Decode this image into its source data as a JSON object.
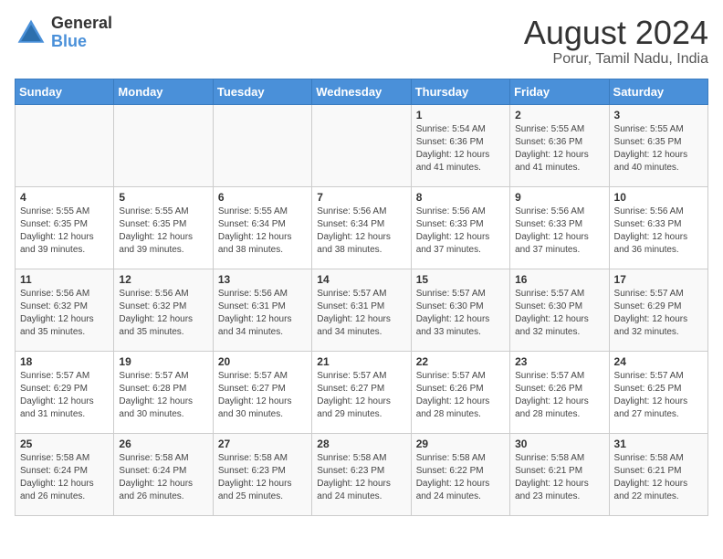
{
  "header": {
    "logo_general": "General",
    "logo_blue": "Blue",
    "main_title": "August 2024",
    "subtitle": "Porur, Tamil Nadu, India"
  },
  "calendar": {
    "days_of_week": [
      "Sunday",
      "Monday",
      "Tuesday",
      "Wednesday",
      "Thursday",
      "Friday",
      "Saturday"
    ],
    "weeks": [
      [
        {
          "day": "",
          "info": ""
        },
        {
          "day": "",
          "info": ""
        },
        {
          "day": "",
          "info": ""
        },
        {
          "day": "",
          "info": ""
        },
        {
          "day": "1",
          "info": "Sunrise: 5:54 AM\nSunset: 6:36 PM\nDaylight: 12 hours\nand 41 minutes."
        },
        {
          "day": "2",
          "info": "Sunrise: 5:55 AM\nSunset: 6:36 PM\nDaylight: 12 hours\nand 41 minutes."
        },
        {
          "day": "3",
          "info": "Sunrise: 5:55 AM\nSunset: 6:35 PM\nDaylight: 12 hours\nand 40 minutes."
        }
      ],
      [
        {
          "day": "4",
          "info": "Sunrise: 5:55 AM\nSunset: 6:35 PM\nDaylight: 12 hours\nand 39 minutes."
        },
        {
          "day": "5",
          "info": "Sunrise: 5:55 AM\nSunset: 6:35 PM\nDaylight: 12 hours\nand 39 minutes."
        },
        {
          "day": "6",
          "info": "Sunrise: 5:55 AM\nSunset: 6:34 PM\nDaylight: 12 hours\nand 38 minutes."
        },
        {
          "day": "7",
          "info": "Sunrise: 5:56 AM\nSunset: 6:34 PM\nDaylight: 12 hours\nand 38 minutes."
        },
        {
          "day": "8",
          "info": "Sunrise: 5:56 AM\nSunset: 6:33 PM\nDaylight: 12 hours\nand 37 minutes."
        },
        {
          "day": "9",
          "info": "Sunrise: 5:56 AM\nSunset: 6:33 PM\nDaylight: 12 hours\nand 37 minutes."
        },
        {
          "day": "10",
          "info": "Sunrise: 5:56 AM\nSunset: 6:33 PM\nDaylight: 12 hours\nand 36 minutes."
        }
      ],
      [
        {
          "day": "11",
          "info": "Sunrise: 5:56 AM\nSunset: 6:32 PM\nDaylight: 12 hours\nand 35 minutes."
        },
        {
          "day": "12",
          "info": "Sunrise: 5:56 AM\nSunset: 6:32 PM\nDaylight: 12 hours\nand 35 minutes."
        },
        {
          "day": "13",
          "info": "Sunrise: 5:56 AM\nSunset: 6:31 PM\nDaylight: 12 hours\nand 34 minutes."
        },
        {
          "day": "14",
          "info": "Sunrise: 5:57 AM\nSunset: 6:31 PM\nDaylight: 12 hours\nand 34 minutes."
        },
        {
          "day": "15",
          "info": "Sunrise: 5:57 AM\nSunset: 6:30 PM\nDaylight: 12 hours\nand 33 minutes."
        },
        {
          "day": "16",
          "info": "Sunrise: 5:57 AM\nSunset: 6:30 PM\nDaylight: 12 hours\nand 32 minutes."
        },
        {
          "day": "17",
          "info": "Sunrise: 5:57 AM\nSunset: 6:29 PM\nDaylight: 12 hours\nand 32 minutes."
        }
      ],
      [
        {
          "day": "18",
          "info": "Sunrise: 5:57 AM\nSunset: 6:29 PM\nDaylight: 12 hours\nand 31 minutes."
        },
        {
          "day": "19",
          "info": "Sunrise: 5:57 AM\nSunset: 6:28 PM\nDaylight: 12 hours\nand 30 minutes."
        },
        {
          "day": "20",
          "info": "Sunrise: 5:57 AM\nSunset: 6:27 PM\nDaylight: 12 hours\nand 30 minutes."
        },
        {
          "day": "21",
          "info": "Sunrise: 5:57 AM\nSunset: 6:27 PM\nDaylight: 12 hours\nand 29 minutes."
        },
        {
          "day": "22",
          "info": "Sunrise: 5:57 AM\nSunset: 6:26 PM\nDaylight: 12 hours\nand 28 minutes."
        },
        {
          "day": "23",
          "info": "Sunrise: 5:57 AM\nSunset: 6:26 PM\nDaylight: 12 hours\nand 28 minutes."
        },
        {
          "day": "24",
          "info": "Sunrise: 5:57 AM\nSunset: 6:25 PM\nDaylight: 12 hours\nand 27 minutes."
        }
      ],
      [
        {
          "day": "25",
          "info": "Sunrise: 5:58 AM\nSunset: 6:24 PM\nDaylight: 12 hours\nand 26 minutes."
        },
        {
          "day": "26",
          "info": "Sunrise: 5:58 AM\nSunset: 6:24 PM\nDaylight: 12 hours\nand 26 minutes."
        },
        {
          "day": "27",
          "info": "Sunrise: 5:58 AM\nSunset: 6:23 PM\nDaylight: 12 hours\nand 25 minutes."
        },
        {
          "day": "28",
          "info": "Sunrise: 5:58 AM\nSunset: 6:23 PM\nDaylight: 12 hours\nand 24 minutes."
        },
        {
          "day": "29",
          "info": "Sunrise: 5:58 AM\nSunset: 6:22 PM\nDaylight: 12 hours\nand 24 minutes."
        },
        {
          "day": "30",
          "info": "Sunrise: 5:58 AM\nSunset: 6:21 PM\nDaylight: 12 hours\nand 23 minutes."
        },
        {
          "day": "31",
          "info": "Sunrise: 5:58 AM\nSunset: 6:21 PM\nDaylight: 12 hours\nand 22 minutes."
        }
      ]
    ]
  }
}
